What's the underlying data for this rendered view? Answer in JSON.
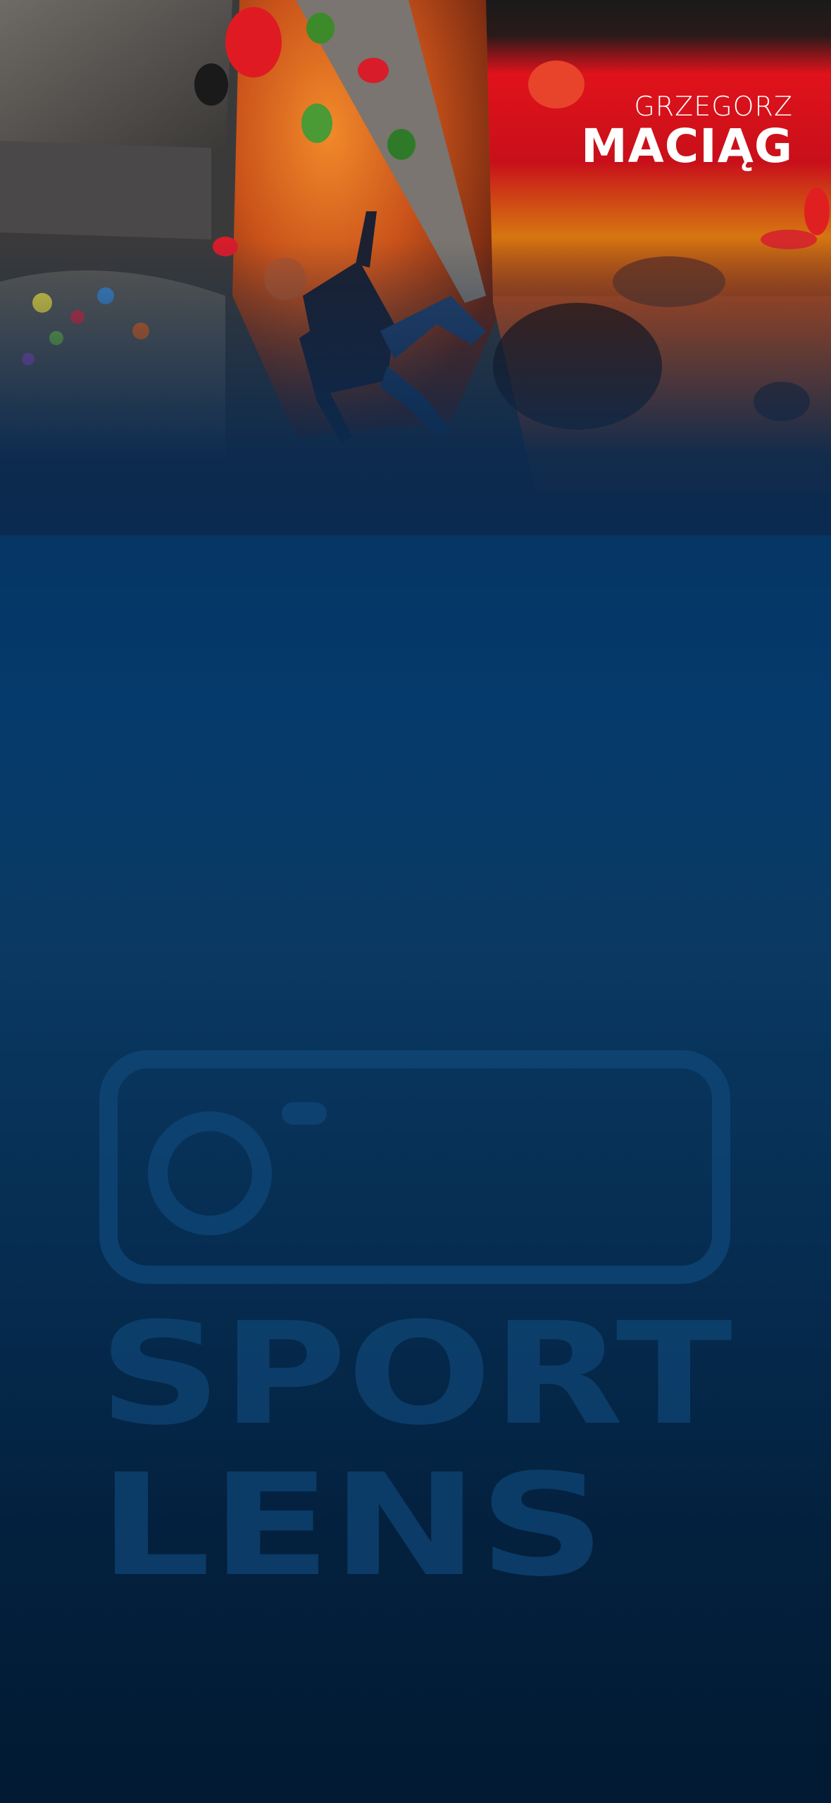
{
  "athlete": {
    "first_name": "GRZEGORZ",
    "last_name": "MACIĄG"
  },
  "hero": {
    "image_subject": "climber-on-bouldering-wall",
    "flag_colors": [
      "#1a1a1a",
      "#e0121b",
      "#f2b705"
    ]
  },
  "watermark": {
    "icon": "camera-icon",
    "line1": "SPORT",
    "line2": "LENS"
  },
  "colors": {
    "background_top": "#053563",
    "background_bottom": "#021a33",
    "wall_orange": "#d9631c",
    "text": "#ffffff"
  }
}
